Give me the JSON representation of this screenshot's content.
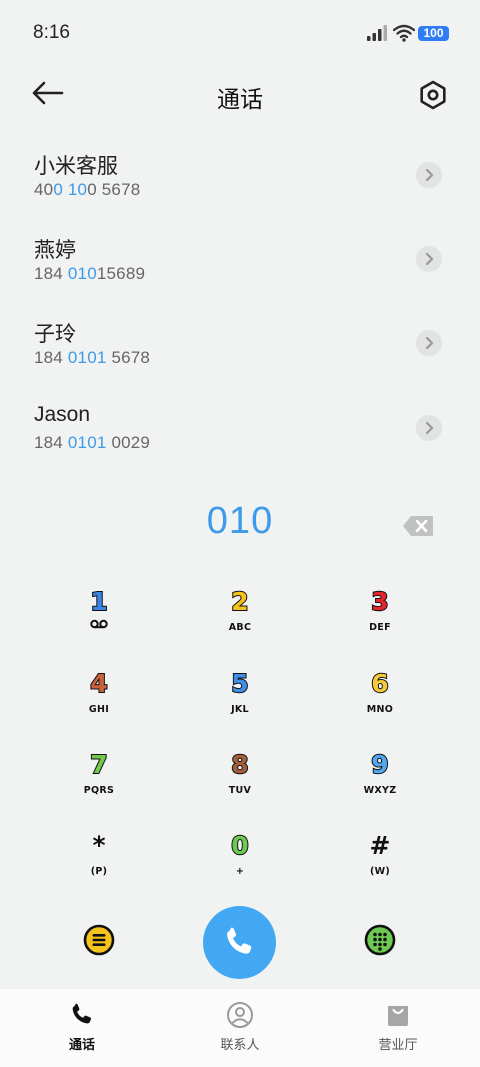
{
  "status_bar": {
    "time": "8:16",
    "battery": "100"
  },
  "header": {
    "title": "通话"
  },
  "contacts": [
    {
      "name": "小米客服",
      "number_parts": [
        "40",
        "0 10",
        "0 5678"
      ]
    },
    {
      "name": "燕婷",
      "number_parts": [
        "184 ",
        "010",
        "15689"
      ]
    },
    {
      "name": "子玲",
      "number_parts": [
        "184 ",
        "0101",
        " 5678"
      ]
    },
    {
      "name": "Jason",
      "number_parts": [
        "184 ",
        "0101",
        " 0029"
      ]
    }
  ],
  "dialed_number": "010",
  "keypad": [
    {
      "digit": "1",
      "letters": "",
      "color": "#3a84e8"
    },
    {
      "digit": "2",
      "letters": "ABC",
      "color": "#f5c31c"
    },
    {
      "digit": "3",
      "letters": "DEF",
      "color": "#e3262a"
    },
    {
      "digit": "4",
      "letters": "GHI",
      "color": "#c8623a"
    },
    {
      "digit": "5",
      "letters": "JKL",
      "color": "#3f8fe8"
    },
    {
      "digit": "6",
      "letters": "MNO",
      "color": "#f6c93a"
    },
    {
      "digit": "7",
      "letters": "PQRS",
      "color": "#71c94b"
    },
    {
      "digit": "8",
      "letters": "TUV",
      "color": "#a2603a"
    },
    {
      "digit": "9",
      "letters": "WXYZ",
      "color": "#52a7ee"
    },
    {
      "digit": "*",
      "letters": "(P)",
      "color": "#111111"
    },
    {
      "digit": "0",
      "letters": "+",
      "color": "#6ec950"
    },
    {
      "digit": "#",
      "letters": "(W)",
      "color": "#111111"
    }
  ],
  "icons": {
    "back": "arrow-left-icon",
    "settings": "hexagon-settings-icon",
    "delete": "backspace-icon",
    "voicemail": "voicemail-icon",
    "menu": "menu-icon",
    "call": "phone-icon",
    "keypad": "dialpad-icon"
  },
  "colors": {
    "accent": "#3d9be9",
    "call_button": "#43a8f3",
    "yellow": "#f5c31c",
    "green": "#6ec950"
  },
  "bottom_nav": [
    {
      "label": "通话",
      "icon": "phone-icon",
      "active": true
    },
    {
      "label": "联系人",
      "icon": "person-icon",
      "active": false
    },
    {
      "label": "营业厅",
      "icon": "shopping-bag-icon",
      "active": false
    }
  ]
}
